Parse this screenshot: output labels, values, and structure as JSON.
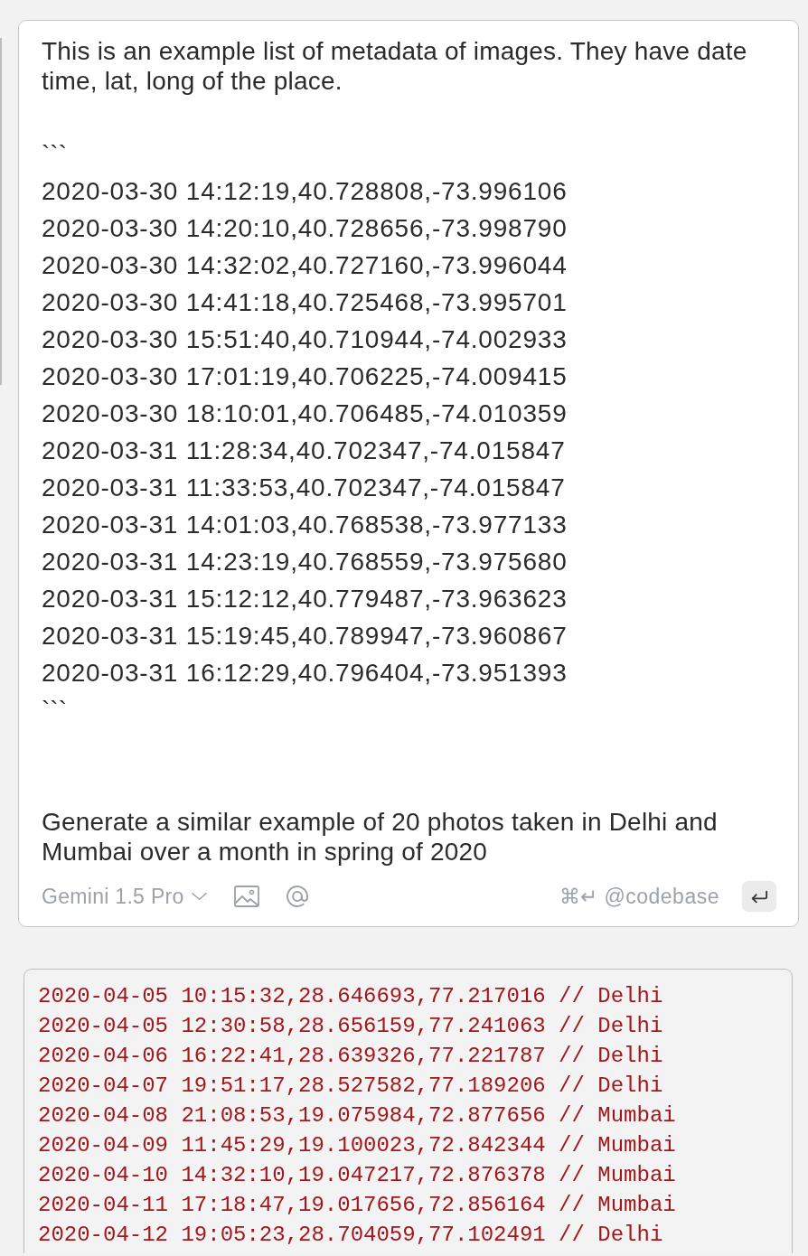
{
  "prompt_card": {
    "intro": "This is an example list of metadata of images. They have date time, lat, long of the place.",
    "fence_open": "```",
    "data_lines": [
      "2020-03-30 14:12:19,40.728808,-73.996106",
      "2020-03-30 14:20:10,40.728656,-73.998790",
      "2020-03-30 14:32:02,40.727160,-73.996044",
      "2020-03-30 14:41:18,40.725468,-73.995701",
      "2020-03-30 15:51:40,40.710944,-74.002933",
      "2020-03-30 17:01:19,40.706225,-74.009415",
      "2020-03-30 18:10:01,40.706485,-74.010359",
      "2020-03-31 11:28:34,40.702347,-74.015847",
      "2020-03-31 11:33:53,40.702347,-74.015847",
      "2020-03-31 14:01:03,40.768538,-73.977133",
      "2020-03-31 14:23:19,40.768559,-73.975680",
      "2020-03-31 15:12:12,40.779487,-73.963623",
      "2020-03-31 15:19:45,40.789947,-73.960867",
      "2020-03-31 16:12:29,40.796404,-73.951393"
    ],
    "fence_close": "```",
    "request": "Generate a similar example of 20 photos taken in Delhi and Mumbai over a month in spring of 2020"
  },
  "toolbar": {
    "model": "Gemini 1.5 Pro",
    "codebase_hint": "⌘↵ @codebase"
  },
  "response": {
    "lines": [
      "2020-04-05 10:15:32,28.646693,77.217016 // Delhi",
      "2020-04-05 12:30:58,28.656159,77.241063 // Delhi",
      "2020-04-06 16:22:41,28.639326,77.221787 // Delhi",
      "2020-04-07 19:51:17,28.527582,77.189206 // Delhi",
      "2020-04-08 21:08:53,19.075984,72.877656 // Mumbai",
      "2020-04-09 11:45:29,19.100023,72.842344 // Mumbai",
      "2020-04-10 14:32:10,19.047217,72.876378 // Mumbai",
      "2020-04-11 17:18:47,19.017656,72.856164 // Mumbai",
      "2020-04-12 19:05:23,28.704059,77.102491 // Delhi"
    ]
  }
}
